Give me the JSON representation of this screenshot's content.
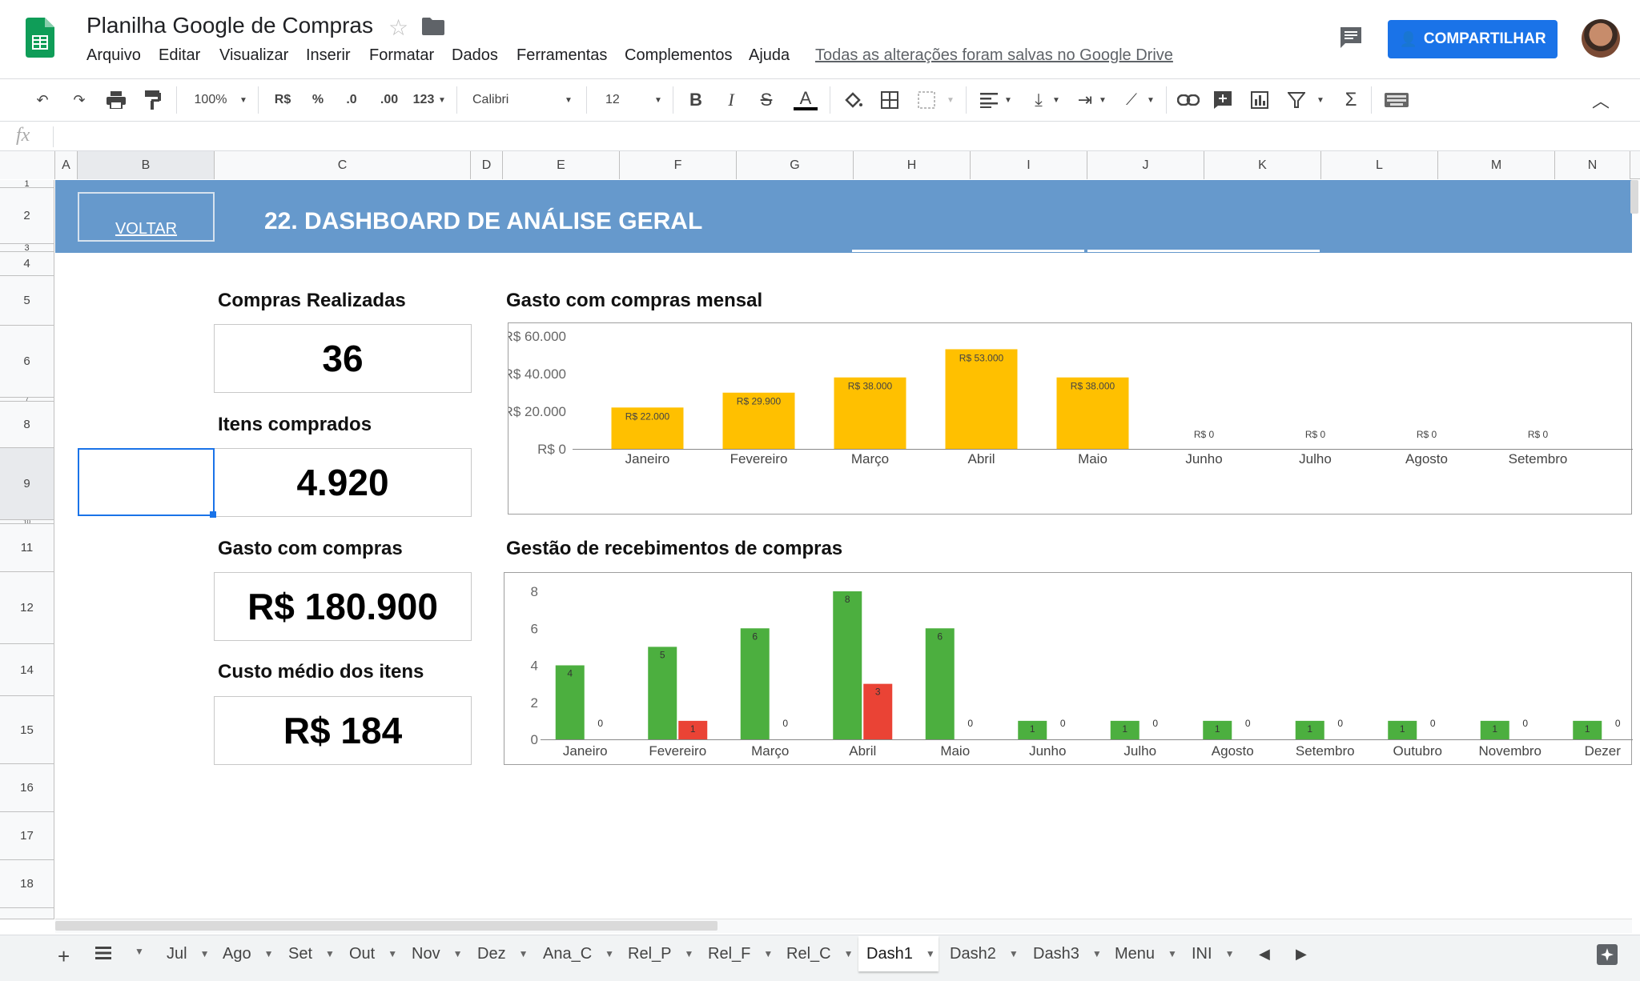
{
  "header": {
    "title": "Planilha Google de Compras",
    "menu": [
      "Arquivo",
      "Editar",
      "Visualizar",
      "Inserir",
      "Formatar",
      "Dados",
      "Ferramentas",
      "Complementos",
      "Ajuda"
    ],
    "saved_message": "Todas as alterações foram salvas no Google Drive",
    "share_label": "COMPARTILHAR"
  },
  "toolbar": {
    "zoom": "100%",
    "currency": "R$",
    "percent": "%",
    "dec_less": ".0",
    "dec_more": ".00",
    "more_formats": "123",
    "font": "Calibri",
    "font_size": "12"
  },
  "formula_bar": {
    "fx": "fx",
    "value": ""
  },
  "columns": [
    "A",
    "B",
    "C",
    "D",
    "E",
    "F",
    "G",
    "H",
    "I",
    "J",
    "K",
    "L",
    "M",
    "N"
  ],
  "rows": [
    "1",
    "2",
    "3",
    "4",
    "5",
    "6",
    "7",
    "8",
    "9",
    "10",
    "11",
    "12",
    "14",
    "15",
    "16",
    "17",
    "18"
  ],
  "banner": {
    "back_label": "VOLTAR",
    "title": "22. DASHBOARD DE ANÁLISE GERAL"
  },
  "kpis": [
    {
      "label": "Compras Realizadas",
      "value": "36"
    },
    {
      "label": "Itens comprados",
      "value": "4.920"
    },
    {
      "label": "Gasto com compras",
      "value": "R$ 180.900"
    },
    {
      "label": "Custo médio dos itens",
      "value": "R$ 184"
    }
  ],
  "chart_data": [
    {
      "type": "bar",
      "title": "Gasto com compras mensal",
      "categories": [
        "Janeiro",
        "Fevereiro",
        "Março",
        "Abril",
        "Maio",
        "Junho",
        "Julho",
        "Agosto",
        "Setembro"
      ],
      "values": [
        22000,
        29900,
        38000,
        53000,
        38000,
        0,
        0,
        0,
        0
      ],
      "value_labels": [
        "R$ 22.000",
        "R$ 29.900",
        "R$ 38.000",
        "R$ 53.000",
        "R$ 38.000",
        "R$ 0",
        "R$ 0",
        "R$ 0",
        "R$ 0"
      ],
      "ylim": [
        0,
        60000
      ],
      "yticks": [
        0,
        20000,
        40000,
        60000
      ],
      "ytick_labels": [
        "R$ 0",
        "R$ 20.000",
        "R$ 40.000",
        "R$ 60.000"
      ],
      "grid": false,
      "color": "#ffc000"
    },
    {
      "type": "bar",
      "title": "Gestão de recebimentos de compras",
      "categories": [
        "Janeiro",
        "Fevereiro",
        "Março",
        "Abril",
        "Maio",
        "Junho",
        "Julho",
        "Agosto",
        "Setembro",
        "Outubro",
        "Novembro",
        "Dezembro"
      ],
      "category_labels": [
        "Janeiro",
        "Fevereiro",
        "Março",
        "Abril",
        "Maio",
        "Junho",
        "Julho",
        "Agosto",
        "Setembro",
        "Outubro",
        "Novembro",
        "Dezer"
      ],
      "series": [
        {
          "values": [
            4,
            5,
            6,
            8,
            6,
            1,
            1,
            1,
            1,
            1,
            1,
            1
          ],
          "color": "#4caf3f"
        },
        {
          "values": [
            0,
            1,
            0,
            3,
            0,
            0,
            0,
            0,
            0,
            0,
            0,
            0
          ],
          "color": "#ea4335"
        }
      ],
      "ylim": [
        0,
        8
      ],
      "yticks": [
        0,
        2,
        4,
        6,
        8
      ],
      "grid": false
    }
  ],
  "sheet_tabs": [
    "Jul",
    "Ago",
    "Set",
    "Out",
    "Nov",
    "Dez",
    "Ana_C",
    "Rel_P",
    "Rel_F",
    "Rel_C",
    "Dash1",
    "Dash2",
    "Dash3",
    "Menu",
    "INI"
  ],
  "active_tab": "Dash1",
  "colors": {
    "banner": "#6699cc",
    "accent": "#1a73e8"
  }
}
